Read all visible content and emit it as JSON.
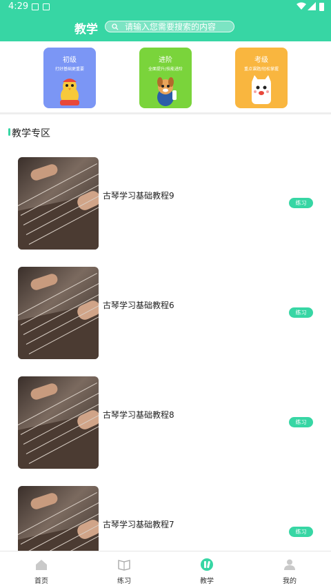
{
  "status_bar": {
    "time": "4:29"
  },
  "header": {
    "title": "教学",
    "search_placeholder": "请输入您需要搜索的内容"
  },
  "levels": [
    {
      "title": "初级",
      "subtitle": "打好基础更重要",
      "color": "#7b96f5"
    },
    {
      "title": "进阶",
      "subtitle": "全面提升/技能进阶",
      "color": "#7ad43b"
    },
    {
      "title": "考级",
      "subtitle": "重点课题/轻松掌握",
      "color": "#f9b63f"
    }
  ],
  "section": {
    "title": "教学专区"
  },
  "courses": [
    {
      "title": "古琴学习基础教程9",
      "action": "练习"
    },
    {
      "title": "古琴学习基础教程6",
      "action": "练习"
    },
    {
      "title": "古琴学习基础教程8",
      "action": "练习"
    },
    {
      "title": "古琴学习基础教程7",
      "action": "练习"
    }
  ],
  "nav": [
    {
      "label": "首页",
      "icon": "home-icon"
    },
    {
      "label": "练习",
      "icon": "book-icon"
    },
    {
      "label": "教学",
      "icon": "teaching-icon"
    },
    {
      "label": "我的",
      "icon": "user-icon"
    }
  ],
  "colors": {
    "accent": "#37d6a4"
  }
}
